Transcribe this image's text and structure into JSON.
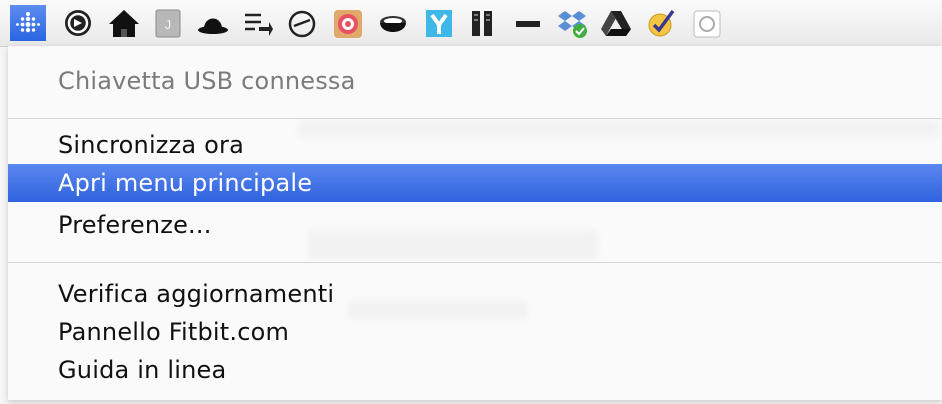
{
  "menubar": {
    "icons": [
      {
        "name": "fitbit-icon",
        "active": true
      },
      {
        "name": "circle-arrow-icon"
      },
      {
        "name": "house-icon"
      },
      {
        "name": "notepad-icon"
      },
      {
        "name": "bowler-hat-icon"
      },
      {
        "name": "airplay-arrow-icon"
      },
      {
        "name": "clock-icon"
      },
      {
        "name": "target-icon"
      },
      {
        "name": "coffee-cup-icon"
      },
      {
        "name": "yoink-icon"
      },
      {
        "name": "book-icon"
      },
      {
        "name": "minus-bar-icon"
      },
      {
        "name": "dropbox-icon"
      },
      {
        "name": "google-drive-icon"
      },
      {
        "name": "checkmark-icon"
      },
      {
        "name": "spotlight-icon"
      }
    ]
  },
  "menu": {
    "status": "Chiavetta USB connessa",
    "items": [
      {
        "label": "Sincronizza ora"
      },
      {
        "label": "Apri menu principale",
        "highlighted": true
      },
      {
        "label": "Preferenze..."
      },
      {
        "label": "Verifica aggiornamenti"
      },
      {
        "label": "Pannello Fitbit.com"
      },
      {
        "label": "Guida in linea"
      }
    ]
  },
  "colors": {
    "highlight": "#3b6ee6",
    "disabled_text": "#7b7b7b"
  }
}
